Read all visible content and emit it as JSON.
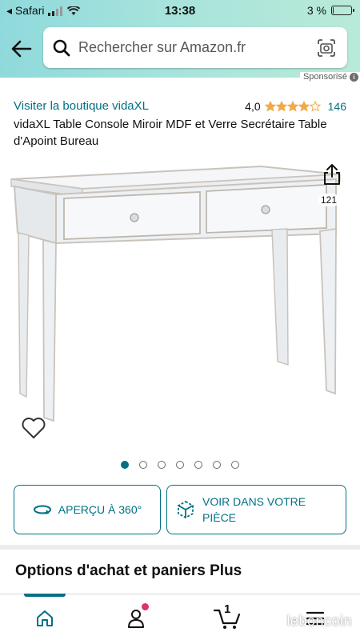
{
  "status_bar": {
    "app_back": "◂ Safari",
    "time": "13:38",
    "battery_text": "3 %",
    "battery_level_percent": 3
  },
  "search": {
    "placeholder": "Rechercher sur Amazon.fr"
  },
  "sponsored_label": "Sponsorisé",
  "product": {
    "store_link": "Visiter la boutique vidaXL",
    "rating_value": "4,0",
    "rating_stars": 4,
    "rating_count": "146",
    "title": "vidaXL Table Console Miroir MDF et Verre Secrétaire Table d'Apoint Bureau",
    "share_count": "121",
    "image_count": 7,
    "active_image_index": 0
  },
  "actions": {
    "view_360_label": "APERÇU À 360°",
    "view_in_room_label": "VOIR DANS VOTRE PIÈCE"
  },
  "section_title": "Options d'achat et paniers Plus",
  "bottom_nav": {
    "cart_count": "1",
    "active": "home"
  },
  "watermark": "leboncoin",
  "colors": {
    "accent": "#007185",
    "header_start": "#8fd9dc",
    "header_end": "#b9ead8",
    "star": "#f3a847",
    "notification": "#e1306c"
  },
  "icons": [
    "back-arrow-icon",
    "search-icon",
    "camera-icon",
    "share-icon",
    "heart-icon",
    "rotate-360-icon",
    "cube-ar-icon",
    "home-icon",
    "user-icon",
    "cart-icon",
    "menu-icon",
    "wifi-icon",
    "signal-icon",
    "battery-icon",
    "info-icon"
  ]
}
